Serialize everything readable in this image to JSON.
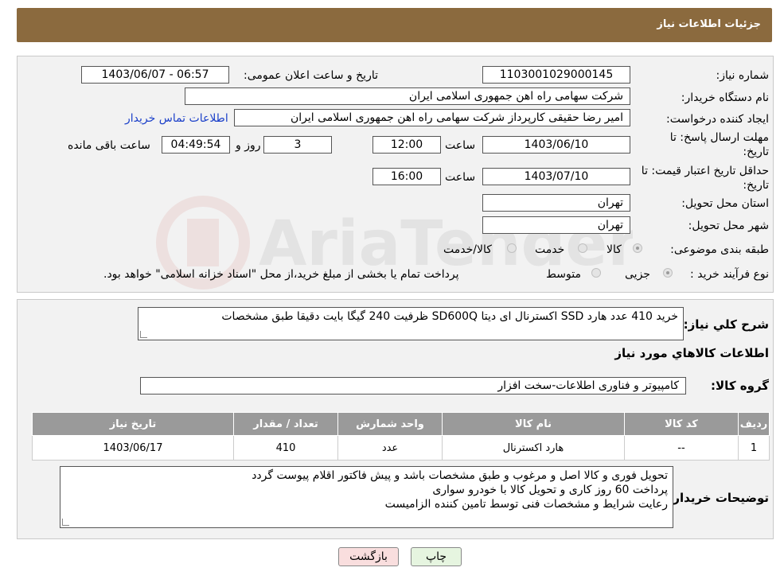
{
  "header": {
    "title": "جزئیات اطلاعات نیاز"
  },
  "form": {
    "need_number_label": "شماره نیاز:",
    "need_number": "1103001029000145",
    "announce_label": "تاریخ و ساعت اعلان عمومی:",
    "announce_value": "1403/06/07 - 06:57",
    "buyer_org_label": "نام دستگاه خریدار:",
    "buyer_org": "شرکت سهامی راه اهن جمهوری اسلامی ایران",
    "creator_label": "ایجاد کننده درخواست:",
    "creator": "امیر رضا  حقیقی کارپرداز شرکت سهامی راه اهن جمهوری اسلامی ایران",
    "contact_link": "اطلاعات تماس خریدار",
    "reply_deadline_label_1": "مهلت ارسال پاسخ: تا",
    "reply_deadline_label_2": "تاریخ:",
    "reply_date": "1403/06/10",
    "time_label": "ساعت",
    "reply_time": "12:00",
    "days": "3",
    "days_label": "روز و",
    "remaining": "04:49:54",
    "remaining_label": "ساعت باقی مانده",
    "price_validity_label_1": "حداقل تاریخ اعتبار قیمت: تا",
    "price_validity_label_2": "تاریخ:",
    "price_date": "1403/07/10",
    "price_time": "16:00",
    "province_label": "استان محل تحویل:",
    "province": "تهران",
    "city_label": "شهر محل تحویل:",
    "city": "تهران",
    "category_label": "طبقه بندی موضوعی:",
    "category_options": [
      "کالا",
      "خدمت",
      "کالا/خدمت"
    ],
    "category_selected": 0,
    "purchase_type_label": "نوع فرآیند خرید :",
    "purchase_options": [
      "جزیی",
      "متوسط"
    ],
    "purchase_selected": 0,
    "purchase_note": "پرداخت تمام یا بخشی از مبلغ خرید،از محل \"اسناد خزانه اسلامی\" خواهد بود."
  },
  "description": {
    "label": "شرح کلي نياز:",
    "text": "خرید 410 عدد هارد SSD اکسترنال ای دیتا SD600Q  ظرفیت 240 گیگا بایت دقیقا طبق مشخصات"
  },
  "goods": {
    "section_title": "اطلاعات کالاهاي مورد نياز",
    "group_label": "گروه کالا:",
    "group_value": "کامپیوتر و فناوری اطلاعات-سخت افزار",
    "columns": [
      "ردیف",
      "کد کالا",
      "نام کالا",
      "واحد شمارش",
      "تعداد / مقدار",
      "تاریخ نیاز"
    ],
    "rows": [
      [
        "1",
        "--",
        "هارد اکسترنال",
        "عدد",
        "410",
        "1403/06/17"
      ]
    ]
  },
  "buyer_notes": {
    "label": "توضیحات خریدار:",
    "lines": [
      "تحویل فوری و کالا اصل و مرغوب و طبق مشخصات باشد و پیش فاکتور اقلام پیوست گردد",
      "پرداخت 60 روز کاری و تحویل کالا با خودرو سواری",
      "رعایت شرایط و مشخصات فنی توسط تامین کننده الزامیست"
    ]
  },
  "buttons": {
    "print": "چاپ",
    "back": "بازگشت"
  },
  "watermark": {
    "text": "AriaTender.neT"
  },
  "colors": {
    "header": "#8b6a3e",
    "table_header": "#9a9a9a",
    "link": "#1a3fc9",
    "back_button": "#f9dede",
    "print_button": "#e6f5e0"
  }
}
